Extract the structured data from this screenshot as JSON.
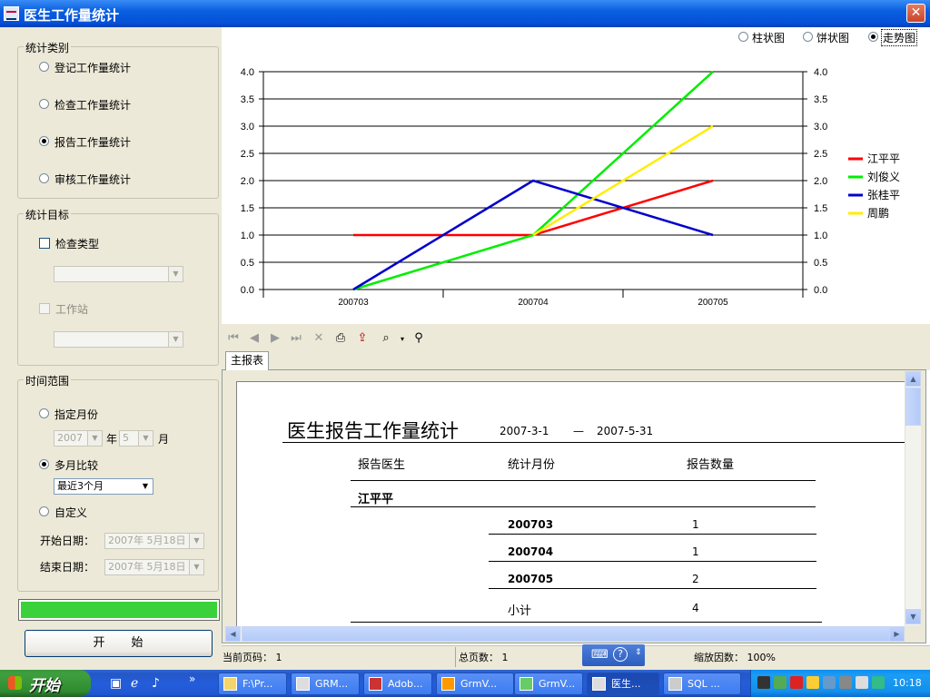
{
  "window": {
    "title": "医生工作量统计",
    "close_glyph": "✕"
  },
  "stat_type": {
    "legend": "统计类别",
    "options": [
      {
        "label": "登记工作量统计",
        "selected": false
      },
      {
        "label": "检查工作量统计",
        "selected": false
      },
      {
        "label": "报告工作量统计",
        "selected": true
      },
      {
        "label": "审核工作量统计",
        "selected": false
      }
    ]
  },
  "stat_target": {
    "legend": "统计目标",
    "check_type_label": "检查类型",
    "workstation_label": "工作站"
  },
  "time_range": {
    "legend": "时间范围",
    "specific_month_label": "指定月份",
    "year_value": "2007",
    "year_suffix": "年",
    "month_value": "5",
    "month_suffix": "月",
    "multi_month_label": "多月比较",
    "multi_month_value": "最近3个月",
    "custom_label": "自定义",
    "start_date_label": "开始日期：",
    "start_date_value": "2007年 5月18日",
    "end_date_label": "结束日期：",
    "end_date_value": "2007年 5月18日",
    "selected": "multi_month"
  },
  "progress": {
    "value": 1.0
  },
  "start_button": {
    "label": "开　　始"
  },
  "chart_tabs": [
    {
      "label": "柱状图",
      "selected": false
    },
    {
      "label": "饼状图",
      "selected": false
    },
    {
      "label": "走势图",
      "selected": true
    }
  ],
  "chart_data": {
    "type": "line",
    "categories": [
      "200703",
      "200704",
      "200705"
    ],
    "ylim": [
      0,
      4
    ],
    "yticks": [
      "0.0",
      "0.5",
      "1.0",
      "1.5",
      "2.0",
      "2.5",
      "3.0",
      "3.5",
      "4.0"
    ],
    "grid": true,
    "legend_position": "right",
    "series": [
      {
        "name": "江平平",
        "values": [
          1,
          1,
          2
        ],
        "color": "#ff0000"
      },
      {
        "name": "刘俊义",
        "values": [
          0,
          1,
          4
        ],
        "color": "#00ee00"
      },
      {
        "name": "张桂平",
        "values": [
          0,
          2,
          1
        ],
        "color": "#0000cc"
      },
      {
        "name": "周鹏",
        "values": [
          null,
          1,
          3
        ],
        "color": "#ffee00"
      }
    ]
  },
  "toolbar": {
    "first_icon": "first-page-icon",
    "prev_icon": "prev-page-icon",
    "next_icon": "next-page-icon",
    "last_icon": "last-page-icon",
    "close_icon": "close-icon",
    "print_icon": "printer-icon",
    "export_icon": "export-icon",
    "zoom_icon": "zoom-icon",
    "find_icon": "binoculars-icon"
  },
  "report_tab": {
    "label": "主报表"
  },
  "report": {
    "title": "医生报告工作量统计",
    "date_from": "2007-3-1",
    "date_sep": "—",
    "date_to": "2007-5-31",
    "col_doctor": "报告医生",
    "col_month": "统计月份",
    "col_count": "报告数量",
    "doctor_name": "江平平",
    "rows": [
      {
        "month": "200703",
        "count": "1"
      },
      {
        "month": "200704",
        "count": "1"
      },
      {
        "month": "200705",
        "count": "2"
      }
    ],
    "subtotal_label": "小计",
    "subtotal_value": "4"
  },
  "statusbar": {
    "current_page": "当前页码：  1",
    "total_pages": "总页数：  1",
    "zoom": "缩放因数：  100%"
  },
  "taskbar": {
    "start_label": "开始",
    "tasks": [
      "F:\\Pr...",
      "GRM...",
      "Adob...",
      "GrmV...",
      "GrmV...",
      "医生...",
      "SQL ..."
    ],
    "clock": "10:18"
  }
}
